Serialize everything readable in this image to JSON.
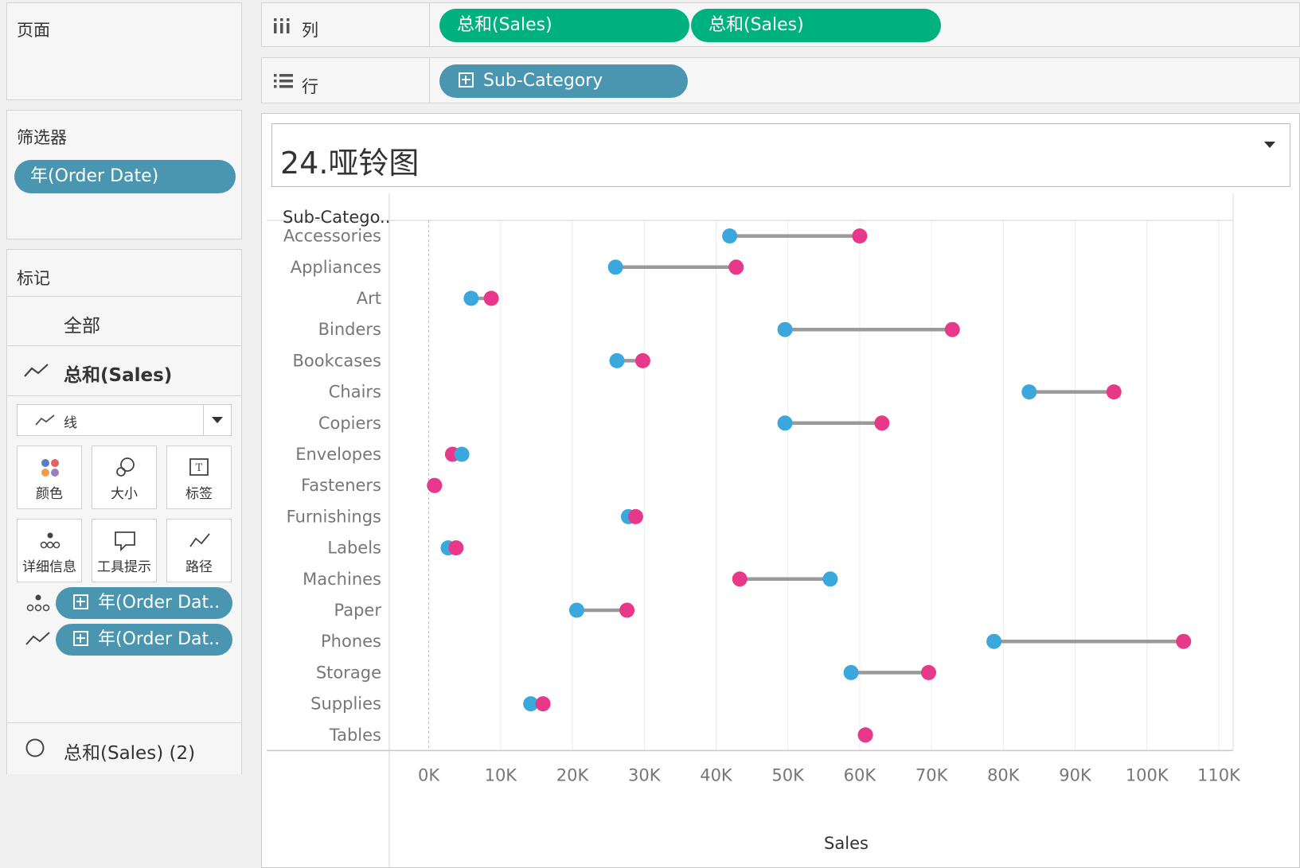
{
  "panels": {
    "pages_title": "页面",
    "filters_title": "筛选器",
    "filter_pill": "年(Order Date)",
    "marks_title": "标记",
    "marks_all": "全部",
    "marks_measure": "总和(Sales)",
    "mark_type": "线",
    "mark_buttons": {
      "color": "颜色",
      "size": "大小",
      "label": "标签",
      "detail": "详细信息",
      "tooltip": "工具提示",
      "path": "路径"
    },
    "detail_pill": "年(Order Dat..",
    "path_pill": "年(Order Dat..",
    "marks_second": "总和(Sales) (2)"
  },
  "shelves": {
    "columns_label": "列",
    "columns_pills": [
      "总和(Sales)",
      "总和(Sales)"
    ],
    "rows_label": "行",
    "rows_pill": "Sub-Category"
  },
  "view": {
    "title": "24.哑铃图",
    "row_header": "Sub-Catego.."
  },
  "colors": {
    "accent_green": "#00b180",
    "pill_blue": "#4a96b0",
    "series_blue": "#3aa7dd",
    "series_pink": "#e8388a",
    "connector": "#9a9a9a"
  },
  "chart_data": {
    "type": "dumbbell",
    "xlabel": "Sales",
    "ylabel": "Sub-Catego..",
    "xlim": [
      -5500,
      112000
    ],
    "x_ticks": [
      0,
      10000,
      20000,
      30000,
      40000,
      50000,
      60000,
      70000,
      80000,
      90000,
      100000,
      110000
    ],
    "x_tick_labels": [
      "0K",
      "10K",
      "20K",
      "30K",
      "40K",
      "50K",
      "60K",
      "70K",
      "80K",
      "90K",
      "100K",
      "110K"
    ],
    "grid": true,
    "categories": [
      "Accessories",
      "Appliances",
      "Art",
      "Binders",
      "Bookcases",
      "Chairs",
      "Copiers",
      "Envelopes",
      "Fasteners",
      "Furnishings",
      "Labels",
      "Machines",
      "Paper",
      "Phones",
      "Storage",
      "Supplies",
      "Tables"
    ],
    "series": [
      {
        "color": "#3aa7dd",
        "values": [
          41900,
          26000,
          5900,
          49600,
          26200,
          83600,
          49600,
          4600,
          800,
          27800,
          2700,
          55900,
          20600,
          78700,
          58800,
          14200,
          60800
        ]
      },
      {
        "color": "#e8388a",
        "values": [
          60000,
          42800,
          8700,
          72900,
          29800,
          95400,
          63100,
          3300,
          800,
          28800,
          3800,
          43300,
          27600,
          105100,
          69600,
          15900,
          60800
        ]
      }
    ]
  }
}
